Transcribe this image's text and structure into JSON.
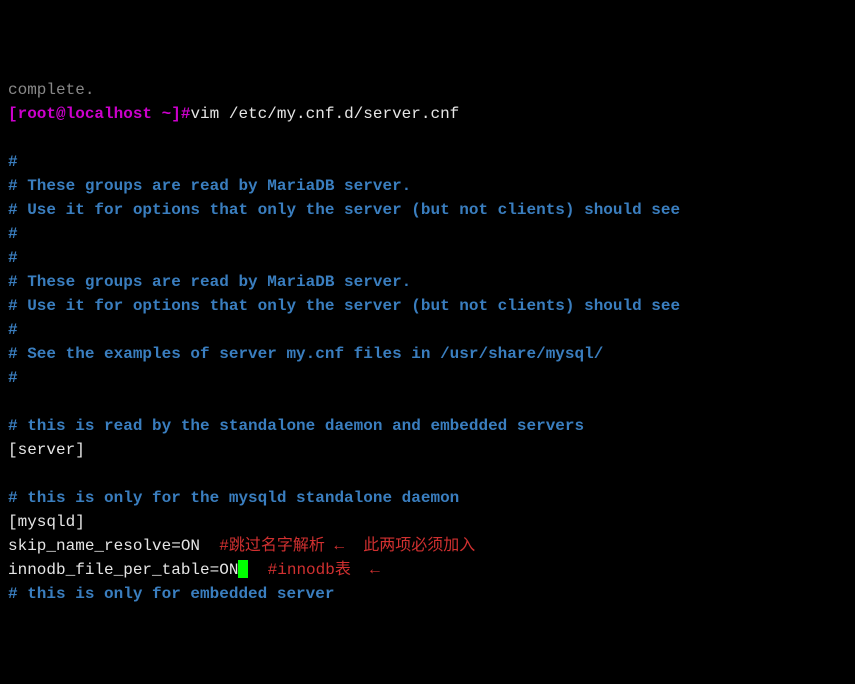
{
  "prompt": {
    "truncated_prev": "complete.",
    "left": "[root@localhost ~]#",
    "command": "vim /etc/my.cnf.d/server.cnf"
  },
  "lines": {
    "c1": "#",
    "c2": "# These groups are read by MariaDB server.",
    "c3": "# Use it for options that only the server (but not clients) should see",
    "c4": "#",
    "c5": "#",
    "c6": "# These groups are read by MariaDB server.",
    "c7": "# Use it for options that only the server (but not clients) should see",
    "c8": "#",
    "c9": "# See the examples of server my.cnf files in /usr/share/mysql/",
    "c10": "#",
    "c11": "# this is read by the standalone daemon and embedded servers",
    "s1": "[server]",
    "c12": "# this is only for the mysqld standalone daemon",
    "s2": "[mysqld]",
    "conf1": "skip_name_resolve=ON",
    "conf2": "innodb_file_per_table=ON",
    "c13": "# this is only for embedded server"
  },
  "annotations": {
    "a1": "#跳过名字解析",
    "a2": "#innodb表",
    "tip": "此两项必须加入",
    "arrow1": "←",
    "arrow2": "←"
  }
}
